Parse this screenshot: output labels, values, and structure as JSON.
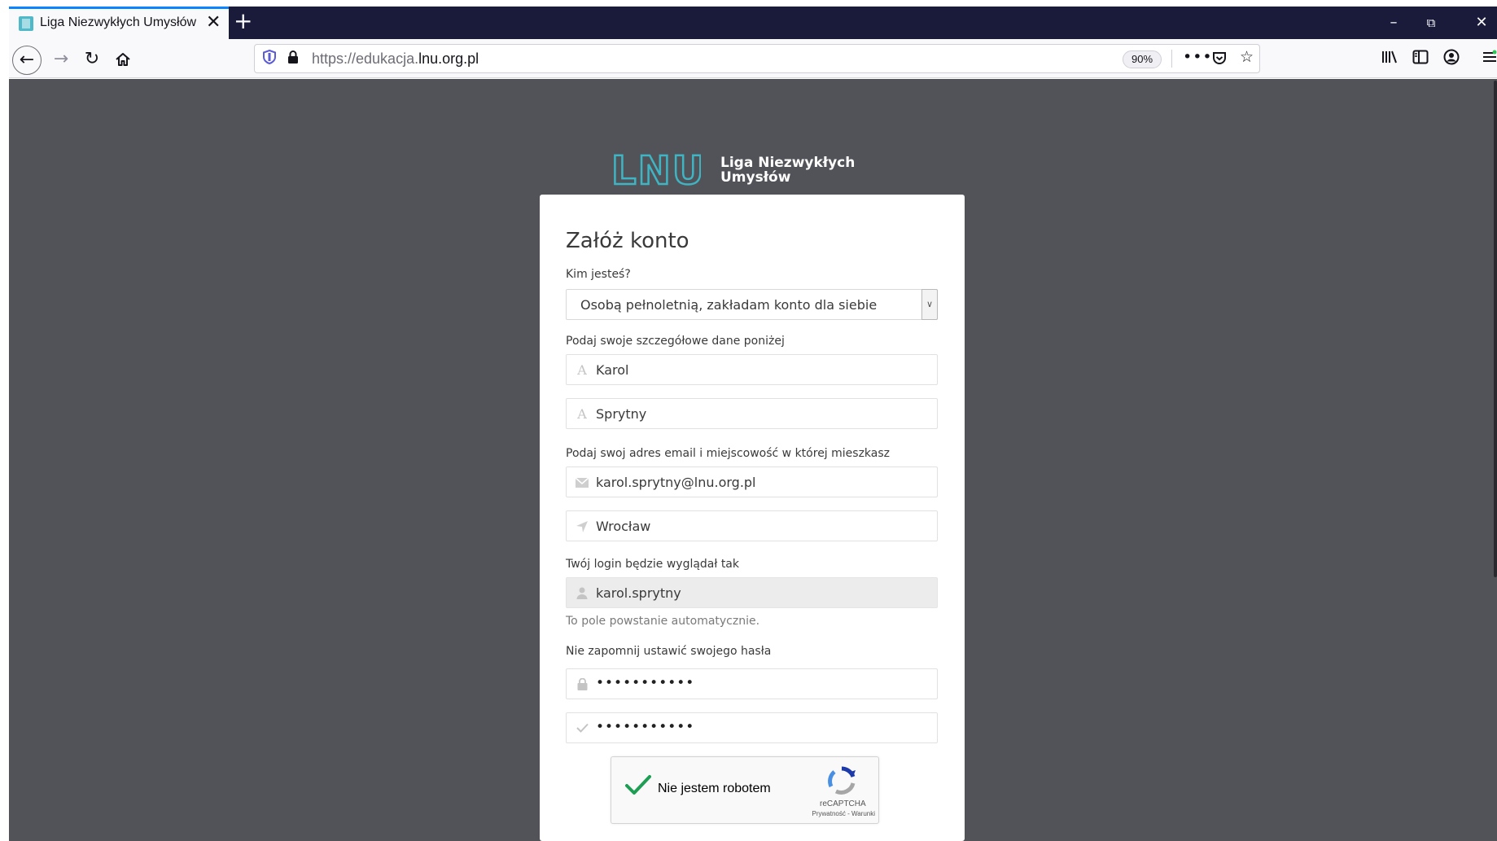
{
  "browser": {
    "tab_title": "Liga Niezwykłych Umysłów",
    "tab_close": "✕",
    "new_tab": "+",
    "url_prefix": "https://edukacja.",
    "url_host": "lnu.org.pl",
    "zoom": "90%",
    "icons": {
      "back": "arrow-left-icon",
      "forward": "arrow-right-icon",
      "reload": "reload-icon",
      "home": "home-icon",
      "shield": "tracking-shield-icon",
      "lock": "lock-icon",
      "more": "more-actions-icon",
      "pocket": "pocket-icon",
      "bookmark": "star-icon",
      "library": "library-icon",
      "sidebar": "sidebar-icon",
      "account": "account-icon",
      "menu": "hamburger-menu-icon"
    }
  },
  "logo": {
    "mark": "LNU",
    "line1": "Liga Niezwykłych",
    "line2": "Umysłów",
    "color": "#3fb4c2"
  },
  "form": {
    "title": "Załóż konto",
    "who_label": "Kim jesteś?",
    "who_value": "Osobą pełnoletnią, zakładam konto dla siebie",
    "details_label": "Podaj swoje szczegółowe dane poniżej",
    "first_name": "Karol",
    "last_name": "Sprytny",
    "contact_label": "Podaj swoj adres email i miejscowość w której mieszkasz",
    "email": "karol.sprytny@lnu.org.pl",
    "city": "Wrocław",
    "login_label": "Twój login będzie wyglądał tak",
    "login": "karol.sprytny",
    "login_helper": "To pole powstanie automatycznie.",
    "password_label": "Nie zapomnij ustawić swojego hasła",
    "password": "•••••••••••",
    "password_confirm": "•••••••••••"
  },
  "captcha": {
    "label": "Nie jestem robotem",
    "brand": "reCAPTCHA",
    "links": "Prywatność - Warunki",
    "checked": true
  },
  "colors": {
    "page_bg": "#525359",
    "tabbar_bg": "#1a1b3a",
    "accent": "#0a84ff",
    "check": "#1e9e54"
  }
}
